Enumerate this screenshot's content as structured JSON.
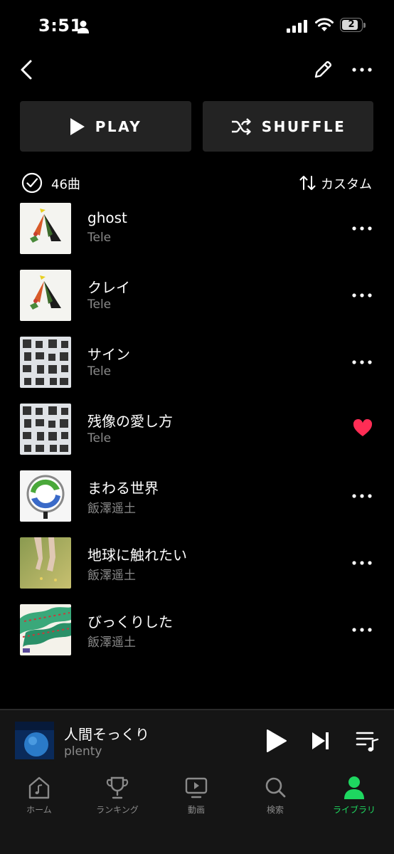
{
  "status": {
    "time": "3:51",
    "battery": "2"
  },
  "actions": {
    "play_label": "PLAY",
    "shuffle_label": "SHUFFLE"
  },
  "list_header": {
    "count": "46曲",
    "sort_label": "カスタム"
  },
  "tracks": [
    {
      "title": "ghost",
      "artist": "Tele",
      "liked": false
    },
    {
      "title": "クレイ",
      "artist": "Tele",
      "liked": false
    },
    {
      "title": "サイン",
      "artist": "Tele",
      "liked": false
    },
    {
      "title": "残像の愛し方",
      "artist": "Tele",
      "liked": true
    },
    {
      "title": "まわる世界",
      "artist": "飯澤遥土",
      "liked": false
    },
    {
      "title": "地球に触れたい",
      "artist": "飯澤遥土",
      "liked": false
    },
    {
      "title": "びっくりした",
      "artist": "飯澤遥土",
      "liked": false
    }
  ],
  "now_playing": {
    "title": "人間そっくり",
    "artist": "plenty"
  },
  "nav": {
    "items": [
      {
        "label": "ホーム",
        "icon": "home-icon"
      },
      {
        "label": "ランキング",
        "icon": "trophy-icon"
      },
      {
        "label": "動画",
        "icon": "video-icon"
      },
      {
        "label": "検索",
        "icon": "search-icon"
      },
      {
        "label": "ライブラリ",
        "icon": "library-icon"
      }
    ],
    "active_index": 4
  },
  "colors": {
    "accent": "#1ed760",
    "heart": "#ff2d55",
    "button_bg": "#232323",
    "secondary_text": "#8a8a8a"
  }
}
